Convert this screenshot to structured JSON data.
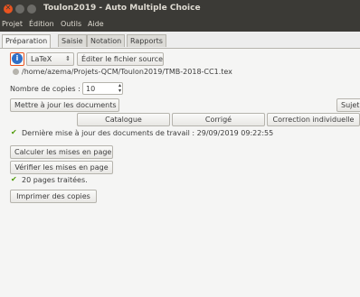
{
  "window": {
    "title": "Toulon2019 - Auto Multiple Choice"
  },
  "menu": [
    "Projet",
    "Édition",
    "Outils",
    "Aide"
  ],
  "tabs": [
    "Préparation",
    "Saisie",
    "Notation",
    "Rapports"
  ],
  "source": {
    "format_value": "LaTeX",
    "edit_label": "Éditer le fichier source",
    "path": "/home/azema/Projets-QCM/Toulon2019/TMB-2018-CC1.tex"
  },
  "copies": {
    "label": "Nombre de copies :",
    "value": "10"
  },
  "docs": {
    "update_label": "Mettre à jour les documents",
    "subject_label": "Sujet",
    "catalog_label": "Catalogue",
    "corrected_label": "Corrigé",
    "individual_label": "Correction individuelle",
    "status": "Dernière mise à jour des documents de travail : 29/09/2019 09:22:55"
  },
  "layout_actions": {
    "compute_label": "Calculer les mises en page",
    "verify_label": "Vérifier les mises en page",
    "status": "20 pages traitées."
  },
  "print_label": "Imprimer des copies"
}
